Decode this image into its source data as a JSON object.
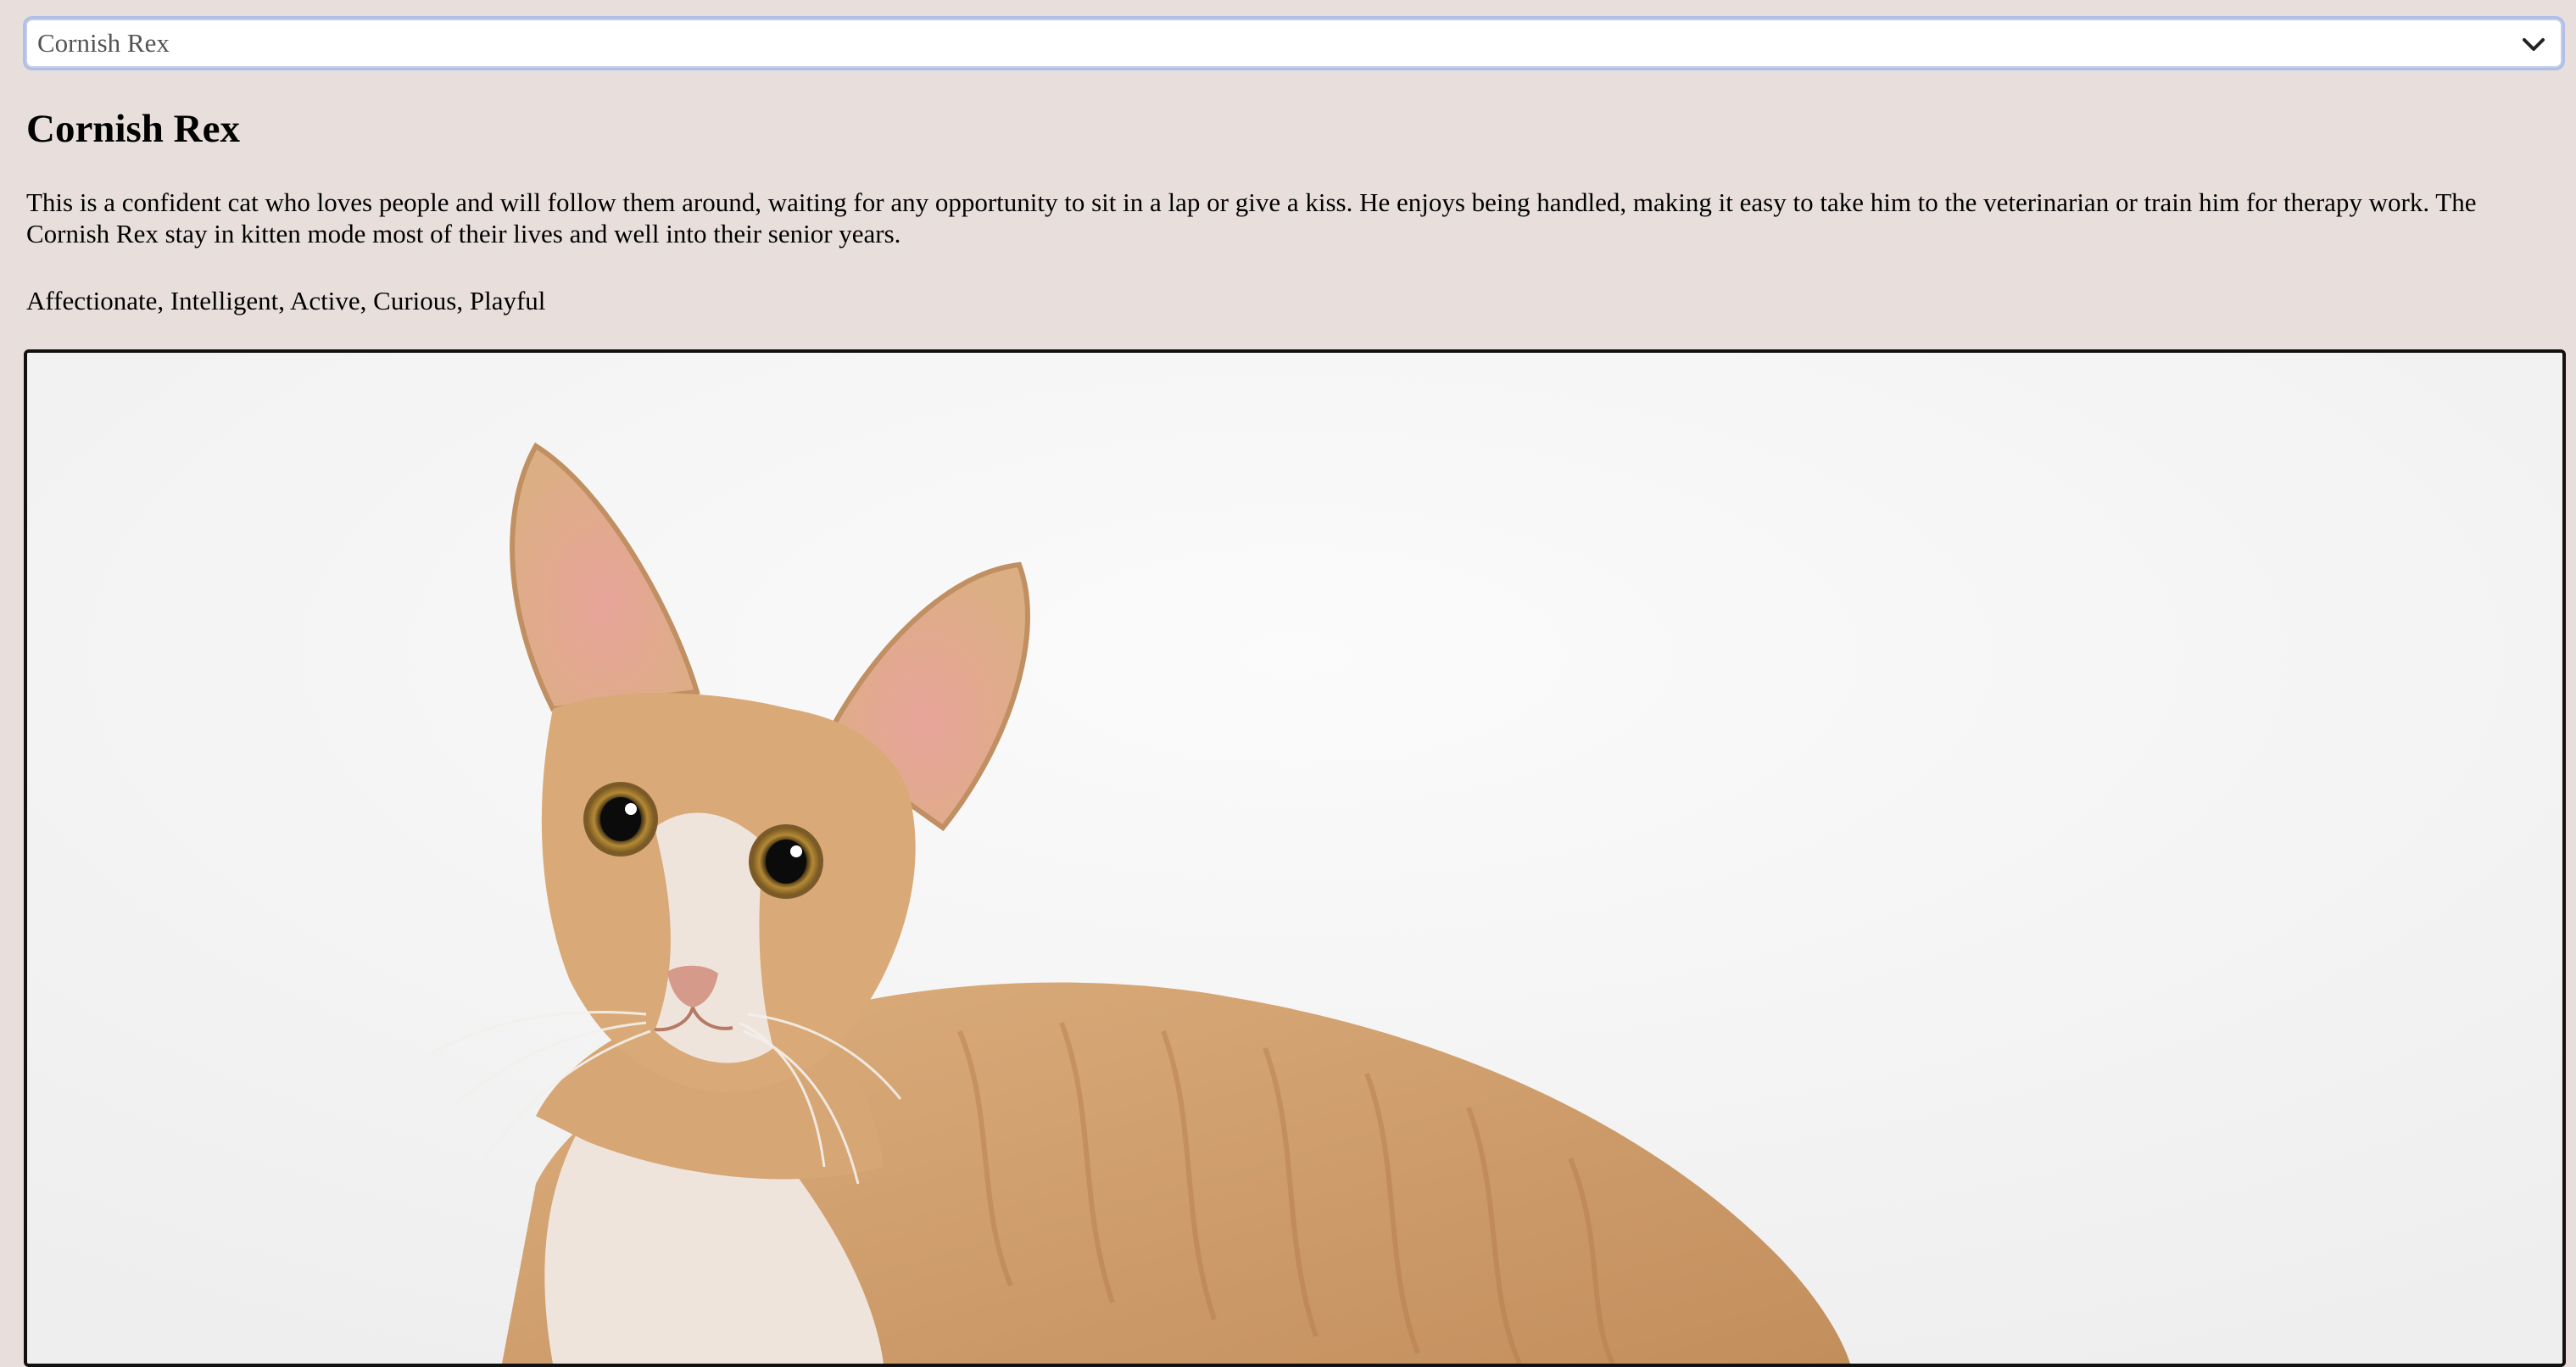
{
  "breed_select": {
    "selected": "Cornish Rex",
    "icon": "chevron-down-icon"
  },
  "breed": {
    "name": "Cornish Rex",
    "description": "This is a confident cat who loves people and will follow them around, waiting for any opportunity to sit in a lap or give a kiss. He enjoys being handled, making it easy to take him to the veterinarian or train him for therapy work. The Cornish Rex stay in kitten mode most of their lives and well into their senior years.",
    "temperament": "Affectionate, Intelligent, Active, Curious, Playful"
  },
  "colors": {
    "page_background": "#e8dfdd",
    "photo_background": "#f7f7f7",
    "cat_fur": "#d2a06d",
    "cat_cream": "#efe4dc"
  }
}
